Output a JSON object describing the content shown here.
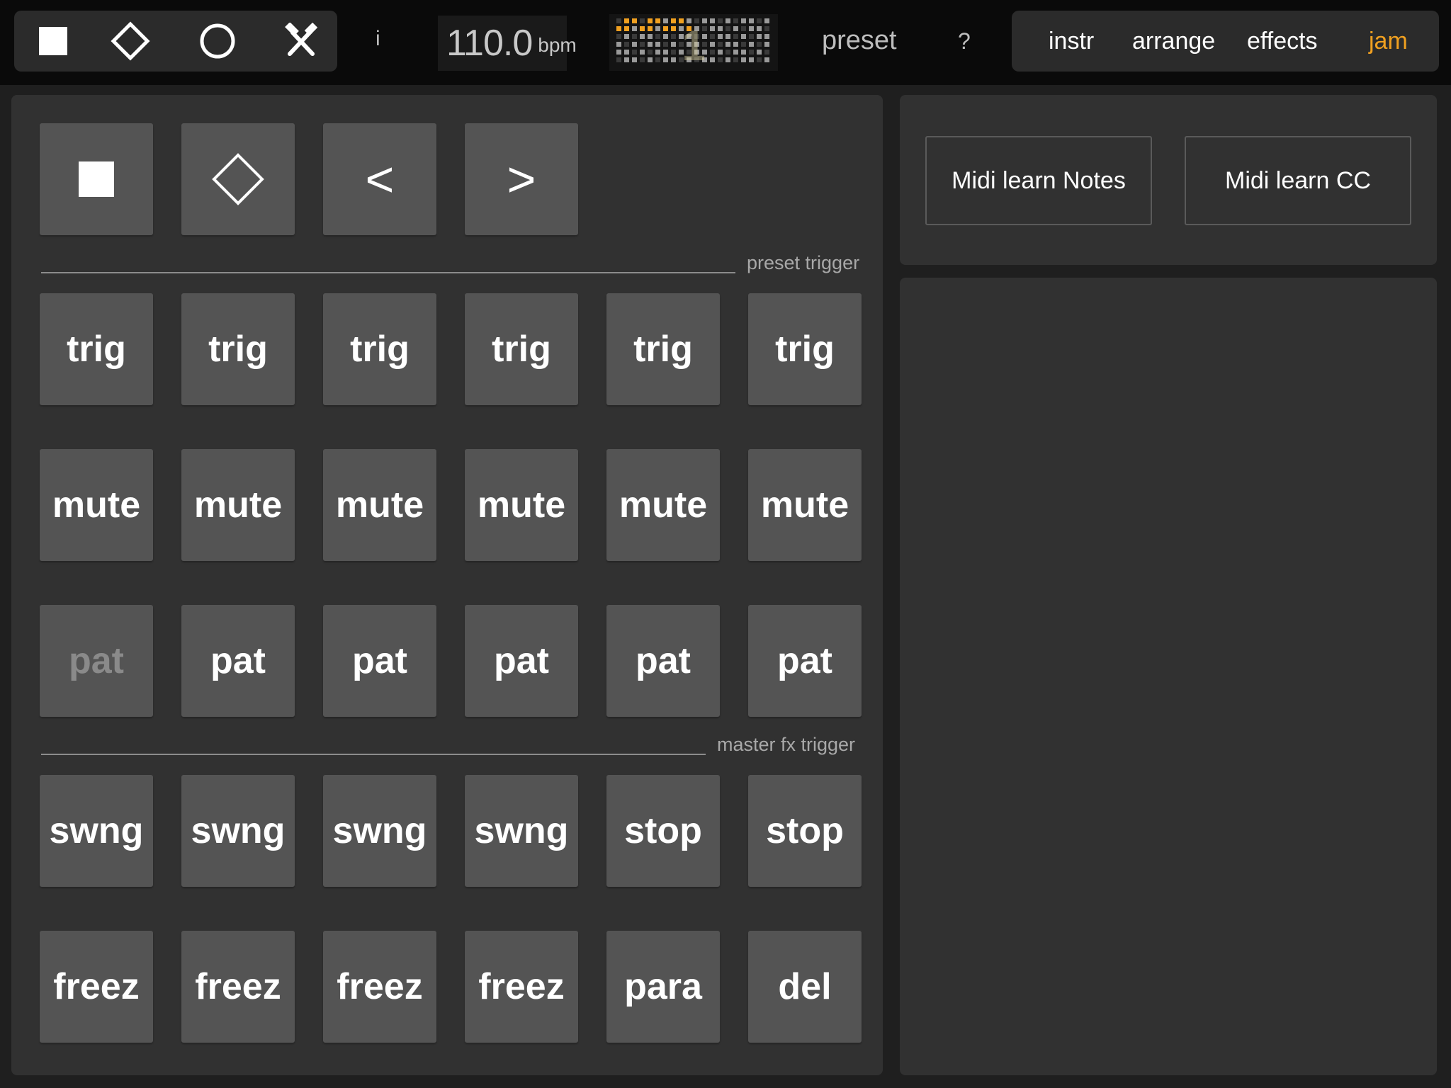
{
  "transport": {
    "stop_icon": "stop-square-icon",
    "play_icon": "diamond-play-icon",
    "record_icon": "circle-record-icon",
    "tools_icon": "hammer-wrench-icon"
  },
  "header": {
    "info_label": "i",
    "bpm_value": "110.0",
    "bpm_unit": "bpm",
    "step_number": "1",
    "preset_label": "preset",
    "help_label": "?",
    "tabs": [
      {
        "label": "instr",
        "active": false
      },
      {
        "label": "arrange",
        "active": false
      },
      {
        "label": "effects",
        "active": false
      },
      {
        "label": "jam",
        "active": true
      }
    ],
    "accent_color": "#f0a020"
  },
  "jam": {
    "preset_trigger_label": "preset trigger",
    "master_fx_trigger_label": "master fx trigger",
    "control_pads": [
      {
        "icon": "stop-square-icon"
      },
      {
        "icon": "diamond-play-icon"
      },
      {
        "label": "<"
      },
      {
        "label": ">"
      }
    ],
    "trig_row": [
      "trig",
      "trig",
      "trig",
      "trig",
      "trig",
      "trig"
    ],
    "mute_row": [
      "mute",
      "mute",
      "mute",
      "mute",
      "mute",
      "mute"
    ],
    "pat_row": [
      "pat",
      "pat",
      "pat",
      "pat",
      "pat",
      "pat"
    ],
    "fx_row_1": [
      "swng",
      "swng",
      "swng",
      "swng",
      "stop",
      "stop"
    ],
    "fx_row_2": [
      "freez",
      "freez",
      "freez",
      "freez",
      "para",
      "del"
    ]
  },
  "midi": {
    "learn_notes_label": "Midi learn Notes",
    "learn_cc_label": "Midi learn CC"
  }
}
